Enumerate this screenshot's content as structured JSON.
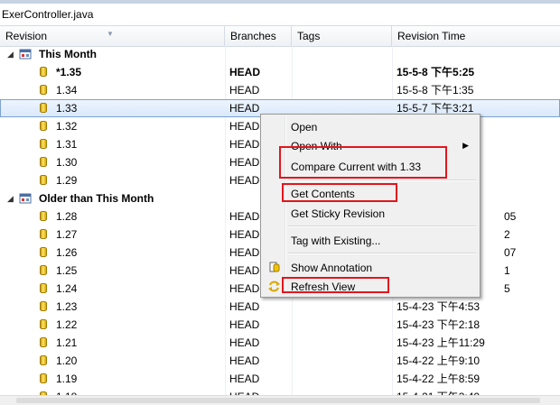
{
  "file_tab": "ExerController.java",
  "columns": {
    "revision": "Revision",
    "branches": "Branches",
    "tags": "Tags",
    "revision_time": "Revision Time"
  },
  "groups": [
    {
      "label": "This Month",
      "rows": [
        {
          "rev": "*1.35",
          "branch": "HEAD",
          "time": "15-5-8 下午5:25",
          "bold": true
        },
        {
          "rev": "1.34",
          "branch": "HEAD",
          "time": "15-5-8 下午1:35"
        },
        {
          "rev": "1.33",
          "branch": "HEAD",
          "time": "15-5-7 下午3:21",
          "selected": true
        },
        {
          "rev": "1.32",
          "branch": "HEAD",
          "time": ""
        },
        {
          "rev": "1.31",
          "branch": "HEAD",
          "time": ""
        },
        {
          "rev": "1.30",
          "branch": "HEAD",
          "time": ""
        },
        {
          "rev": "1.29",
          "branch": "HEAD",
          "time": ""
        }
      ]
    },
    {
      "label": "Older than This Month",
      "rows": [
        {
          "rev": "1.28",
          "branch": "HEAD",
          "time": "05"
        },
        {
          "rev": "1.27",
          "branch": "HEAD",
          "time": "2"
        },
        {
          "rev": "1.26",
          "branch": "HEAD",
          "time": "07"
        },
        {
          "rev": "1.25",
          "branch": "HEAD",
          "time": "1"
        },
        {
          "rev": "1.24",
          "branch": "HEAD",
          "time": "5"
        },
        {
          "rev": "1.23",
          "branch": "HEAD",
          "time": "15-4-23 下午4:53"
        },
        {
          "rev": "1.22",
          "branch": "HEAD",
          "time": "15-4-23 下午2:18"
        },
        {
          "rev": "1.21",
          "branch": "HEAD",
          "time": "15-4-23 上午11:29"
        },
        {
          "rev": "1.20",
          "branch": "HEAD",
          "time": "15-4-22 上午9:10"
        },
        {
          "rev": "1.19",
          "branch": "HEAD",
          "time": "15-4-22 上午8:59"
        },
        {
          "rev": "1.18",
          "branch": "HEAD",
          "time": "15-4-21 下午3:40"
        }
      ]
    }
  ],
  "context_menu": {
    "open": "Open",
    "open_with": "Open With",
    "compare_current": "Compare Current with 1.33",
    "get_contents": "Get Contents",
    "get_sticky": "Get Sticky Revision",
    "tag_existing": "Tag with Existing...",
    "show_annotation": "Show Annotation",
    "refresh_view": "Refresh View"
  },
  "colors": {
    "highlight_box": "#e0161e",
    "selection": "#d9e8fb",
    "menu_bg": "#f0f0f0"
  }
}
